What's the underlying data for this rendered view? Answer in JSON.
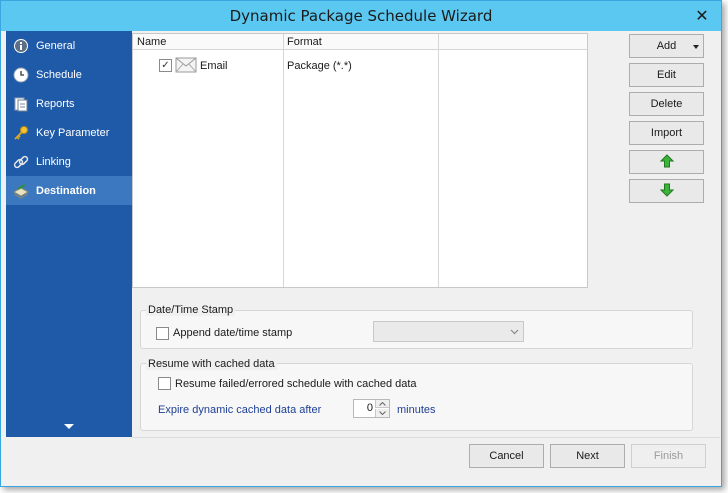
{
  "window": {
    "title": "Dynamic Package Schedule Wizard",
    "close_glyph": "✕"
  },
  "sidebar": {
    "items": [
      {
        "label": "General",
        "icon": "info-icon"
      },
      {
        "label": "Schedule",
        "icon": "clock-icon"
      },
      {
        "label": "Reports",
        "icon": "reports-icon"
      },
      {
        "label": "Key Parameter",
        "icon": "key-icon"
      },
      {
        "label": "Linking",
        "icon": "link-icon"
      },
      {
        "label": "Destination",
        "icon": "destination-icon",
        "active": true
      }
    ]
  },
  "destinations": {
    "columns": [
      "Name",
      "Format"
    ],
    "rows": [
      {
        "checked": true,
        "name": "Email",
        "format": "Package (*.*)"
      }
    ]
  },
  "side_buttons": {
    "add": "Add",
    "edit": "Edit",
    "delete": "Delete",
    "import": "Import"
  },
  "datetime_group": {
    "title": "Date/Time Stamp",
    "append_label": "Append date/time stamp",
    "append_checked": false,
    "format_value": ""
  },
  "cache_group": {
    "title": "Resume with cached data",
    "resume_label": "Resume failed/errored schedule with cached data",
    "resume_checked": false,
    "expire_label": "Expire dynamic cached data after",
    "expire_value": "0",
    "expire_unit": "minutes"
  },
  "footer": {
    "cancel": "Cancel",
    "next": "Next",
    "finish": "Finish"
  },
  "colors": {
    "titlebar": "#5ac8f0",
    "sidebar": "#1e5aa8",
    "sidebar_active": "#3c78c0",
    "arrow_green": "#3cb43c"
  }
}
